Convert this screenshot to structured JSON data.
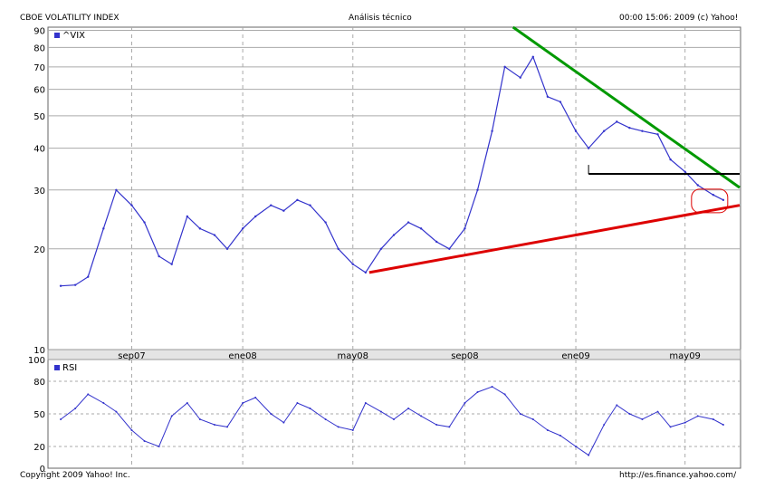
{
  "header": {
    "title": "CBOE VOLATILITY INDEX",
    "center": "Análisis técnico",
    "right": "00:00 15:06: 2009 (c) Yahoo!"
  },
  "footer": {
    "left": "Copyright 2009 Yahoo! Inc.",
    "right": "http://es.finance.yahoo.com/"
  },
  "chart_data": [
    {
      "type": "line",
      "legend": "^VIX",
      "series_color": "#3333cc",
      "y_scale": "log",
      "ylim": [
        10,
        92
      ],
      "y_ticks": [
        10,
        20,
        30,
        40,
        50,
        60,
        70,
        80,
        90
      ],
      "x_ticks": [
        "sep07",
        "ene08",
        "may08",
        "sep08",
        "ene09",
        "may09"
      ],
      "grid": true,
      "x": [
        "2007-06-15",
        "2007-07-01",
        "2007-07-15",
        "2007-08-01",
        "2007-08-15",
        "2007-09-01",
        "2007-09-15",
        "2007-10-01",
        "2007-10-15",
        "2007-11-01",
        "2007-11-15",
        "2007-12-01",
        "2007-12-15",
        "2008-01-01",
        "2008-01-15",
        "2008-02-01",
        "2008-02-15",
        "2008-03-01",
        "2008-03-15",
        "2008-04-01",
        "2008-04-15",
        "2008-05-01",
        "2008-05-15",
        "2008-06-01",
        "2008-06-15",
        "2008-07-01",
        "2008-07-15",
        "2008-08-01",
        "2008-08-15",
        "2008-09-01",
        "2008-09-15",
        "2008-10-01",
        "2008-10-15",
        "2008-11-01",
        "2008-11-15",
        "2008-12-01",
        "2008-12-15",
        "2009-01-01",
        "2009-01-15",
        "2009-02-01",
        "2009-02-15",
        "2009-03-01",
        "2009-03-15",
        "2009-04-01",
        "2009-04-15",
        "2009-05-01",
        "2009-05-15",
        "2009-06-01",
        "2009-06-12"
      ],
      "values": [
        15.5,
        15.6,
        16.5,
        23,
        30,
        27,
        24,
        19,
        18,
        25,
        23,
        22,
        20,
        23,
        25,
        27,
        26,
        28,
        27,
        24,
        20,
        18,
        17,
        20,
        22,
        24,
        23,
        21,
        20,
        23,
        30,
        45,
        70,
        65,
        75,
        57,
        55,
        45,
        40,
        45,
        48,
        46,
        45,
        44,
        37,
        34,
        31,
        29,
        28
      ],
      "annotations": [
        {
          "type": "trendline",
          "color": "#009900",
          "from": [
            "2008-10-24",
            92
          ],
          "to": [
            "2009-06-30",
            30.5
          ]
        },
        {
          "type": "trendline",
          "color": "#dd0000",
          "from": [
            "2008-05-19",
            17
          ],
          "to": [
            "2009-06-30",
            27
          ]
        },
        {
          "type": "hline",
          "color": "#000000",
          "from": "2009-01-15",
          "to": "2009-06-30",
          "value": 33.5
        },
        {
          "type": "ellipse",
          "color": "#dd0000",
          "center": [
            "2009-05-28",
            28
          ],
          "label": ""
        }
      ]
    },
    {
      "type": "line",
      "legend": "RSI",
      "series_color": "#3333cc",
      "ylim": [
        0,
        100
      ],
      "y_ticks": [
        0,
        20,
        50,
        80,
        100
      ],
      "x": [
        "2007-06-15",
        "2007-07-01",
        "2007-07-15",
        "2007-08-01",
        "2007-08-15",
        "2007-09-01",
        "2007-09-15",
        "2007-10-01",
        "2007-10-15",
        "2007-11-01",
        "2007-11-15",
        "2007-12-01",
        "2007-12-15",
        "2008-01-01",
        "2008-01-15",
        "2008-02-01",
        "2008-02-15",
        "2008-03-01",
        "2008-03-15",
        "2008-04-01",
        "2008-04-15",
        "2008-05-01",
        "2008-05-15",
        "2008-06-01",
        "2008-06-15",
        "2008-07-01",
        "2008-07-15",
        "2008-08-01",
        "2008-08-15",
        "2008-09-01",
        "2008-09-15",
        "2008-10-01",
        "2008-10-15",
        "2008-11-01",
        "2008-11-15",
        "2008-12-01",
        "2008-12-15",
        "2009-01-01",
        "2009-01-15",
        "2009-02-01",
        "2009-02-15",
        "2009-03-01",
        "2009-03-15",
        "2009-04-01",
        "2009-04-15",
        "2009-05-01",
        "2009-05-15",
        "2009-06-01",
        "2009-06-12"
      ],
      "values": [
        45,
        55,
        68,
        60,
        52,
        35,
        25,
        20,
        48,
        60,
        45,
        40,
        38,
        60,
        65,
        50,
        42,
        60,
        55,
        45,
        38,
        35,
        60,
        52,
        45,
        55,
        48,
        40,
        38,
        60,
        70,
        75,
        68,
        50,
        45,
        35,
        30,
        20,
        12,
        40,
        58,
        50,
        45,
        52,
        38,
        42,
        48,
        45,
        40
      ]
    }
  ]
}
